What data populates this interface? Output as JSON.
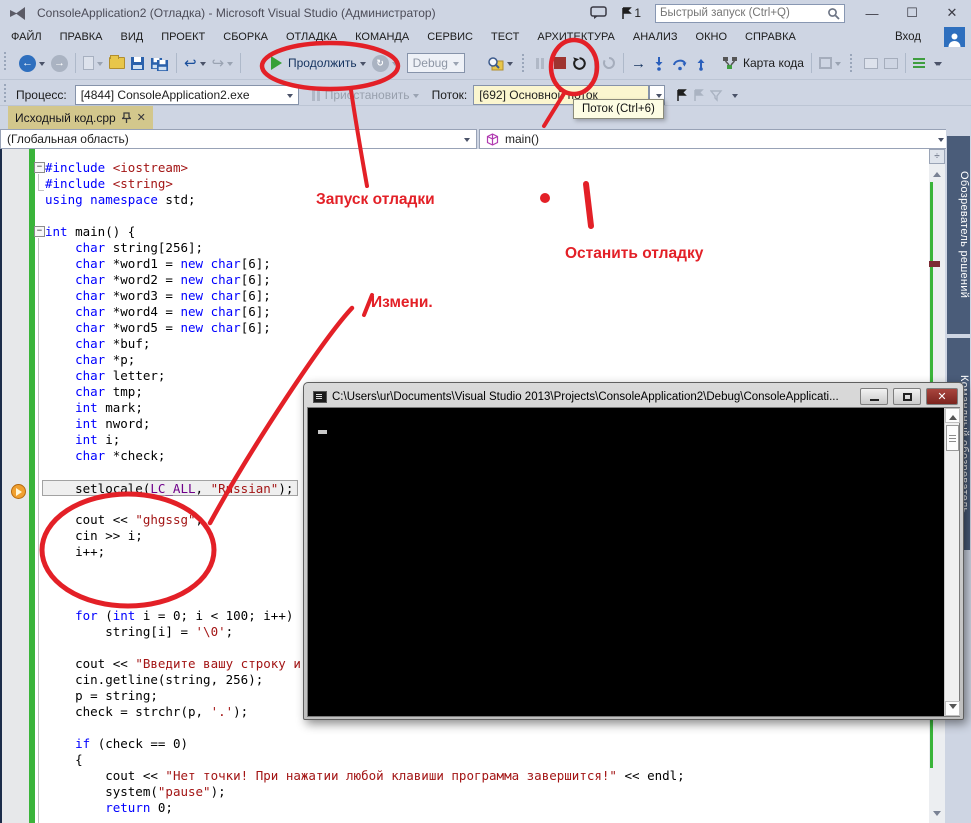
{
  "titlebar": {
    "title": "ConsoleApplication2 (Отладка) - Microsoft Visual Studio (Администратор)",
    "search_placeholder": "Быстрый запуск (Ctrl+Q)",
    "notification_count": "1"
  },
  "menu": {
    "items": [
      "ФАЙЛ",
      "ПРАВКА",
      "ВИД",
      "ПРОЕКТ",
      "СБОРКА",
      "ОТЛАДКА",
      "КОМАНДА",
      "СЕРВИС",
      "ТЕСТ",
      "АРХИТЕКТУРА",
      "АНАЛИЗ",
      "ОКНО",
      "СПРАВКА"
    ],
    "sign_in": "Вход"
  },
  "toolbar": {
    "continue_label": "Продолжить",
    "debug_config": "Debug",
    "code_map_label": "Карта кода"
  },
  "process_bar": {
    "process_label": "Процесс:",
    "process_value": "[4844] ConsoleApplication2.exe",
    "pause_label": "Приостановить",
    "thread_label": "Поток:",
    "thread_value": "[692] Основной поток",
    "tooltip": "Поток (Ctrl+6)"
  },
  "editor": {
    "tab_title": "Исходный код.cpp",
    "scope_dropdown": "(Глобальная область)",
    "member_dropdown": "main()"
  },
  "code": {
    "lines": [
      {
        "seg": [
          [
            "k",
            "#include"
          ],
          [
            "p",
            " "
          ],
          [
            "s",
            "<iostream>"
          ]
        ],
        "fold": true
      },
      {
        "seg": [
          [
            "k",
            "#include"
          ],
          [
            "p",
            " "
          ],
          [
            "s",
            "<string>"
          ]
        ]
      },
      {
        "seg": [
          [
            "k",
            "using"
          ],
          [
            "p",
            " "
          ],
          [
            "k",
            "namespace"
          ],
          [
            "p",
            " std;"
          ]
        ]
      },
      {
        "seg": []
      },
      {
        "seg": [
          [
            "k",
            "int"
          ],
          [
            "p",
            " main() {"
          ]
        ],
        "fold": true
      },
      {
        "seg": [
          [
            "p",
            "    "
          ],
          [
            "k",
            "char"
          ],
          [
            "p",
            " string[256];"
          ]
        ]
      },
      {
        "seg": [
          [
            "p",
            "    "
          ],
          [
            "k",
            "char"
          ],
          [
            "p",
            " *word1 = "
          ],
          [
            "k",
            "new"
          ],
          [
            "p",
            " "
          ],
          [
            "k",
            "char"
          ],
          [
            "p",
            "[6];"
          ]
        ]
      },
      {
        "seg": [
          [
            "p",
            "    "
          ],
          [
            "k",
            "char"
          ],
          [
            "p",
            " *word2 = "
          ],
          [
            "k",
            "new"
          ],
          [
            "p",
            " "
          ],
          [
            "k",
            "char"
          ],
          [
            "p",
            "[6];"
          ]
        ]
      },
      {
        "seg": [
          [
            "p",
            "    "
          ],
          [
            "k",
            "char"
          ],
          [
            "p",
            " *word3 = "
          ],
          [
            "k",
            "new"
          ],
          [
            "p",
            " "
          ],
          [
            "k",
            "char"
          ],
          [
            "p",
            "[6];"
          ]
        ]
      },
      {
        "seg": [
          [
            "p",
            "    "
          ],
          [
            "k",
            "char"
          ],
          [
            "p",
            " *word4 = "
          ],
          [
            "k",
            "new"
          ],
          [
            "p",
            " "
          ],
          [
            "k",
            "char"
          ],
          [
            "p",
            "[6];"
          ]
        ]
      },
      {
        "seg": [
          [
            "p",
            "    "
          ],
          [
            "k",
            "char"
          ],
          [
            "p",
            " *word5 = "
          ],
          [
            "k",
            "new"
          ],
          [
            "p",
            " "
          ],
          [
            "k",
            "char"
          ],
          [
            "p",
            "[6];"
          ]
        ]
      },
      {
        "seg": [
          [
            "p",
            "    "
          ],
          [
            "k",
            "char"
          ],
          [
            "p",
            " *buf;"
          ]
        ]
      },
      {
        "seg": [
          [
            "p",
            "    "
          ],
          [
            "k",
            "char"
          ],
          [
            "p",
            " *p;"
          ]
        ]
      },
      {
        "seg": [
          [
            "p",
            "    "
          ],
          [
            "k",
            "char"
          ],
          [
            "p",
            " letter;"
          ]
        ]
      },
      {
        "seg": [
          [
            "p",
            "    "
          ],
          [
            "k",
            "char"
          ],
          [
            "p",
            " tmp;"
          ]
        ]
      },
      {
        "seg": [
          [
            "p",
            "    "
          ],
          [
            "k",
            "int"
          ],
          [
            "p",
            " mark;"
          ]
        ]
      },
      {
        "seg": [
          [
            "p",
            "    "
          ],
          [
            "k",
            "int"
          ],
          [
            "p",
            " nword;"
          ]
        ]
      },
      {
        "seg": [
          [
            "p",
            "    "
          ],
          [
            "k",
            "int"
          ],
          [
            "p",
            " i;"
          ]
        ]
      },
      {
        "seg": [
          [
            "p",
            "    "
          ],
          [
            "k",
            "char"
          ],
          [
            "p",
            " *check;"
          ]
        ]
      },
      {
        "seg": []
      },
      {
        "seg": [
          [
            "p",
            "    setlocale("
          ],
          [
            "m",
            "LC_ALL"
          ],
          [
            "p",
            ", "
          ],
          [
            "s",
            "\"Russian\""
          ],
          [
            "p",
            ");"
          ]
        ],
        "hl": true
      },
      {
        "seg": []
      },
      {
        "seg": [
          [
            "p",
            "    cout << "
          ],
          [
            "s",
            "\"ghgssg\""
          ],
          [
            "p",
            ";"
          ]
        ]
      },
      {
        "seg": [
          [
            "p",
            "    cin >> i;"
          ]
        ]
      },
      {
        "seg": [
          [
            "p",
            "    i++;"
          ]
        ]
      },
      {
        "seg": []
      },
      {
        "seg": []
      },
      {
        "seg": []
      },
      {
        "seg": [
          [
            "p",
            "    "
          ],
          [
            "k",
            "for"
          ],
          [
            "p",
            " ("
          ],
          [
            "k",
            "int"
          ],
          [
            "p",
            " i = 0; i < 100; i++)"
          ]
        ]
      },
      {
        "seg": [
          [
            "p",
            "        string[i] = "
          ],
          [
            "s",
            "'\\0'"
          ],
          [
            "p",
            ";"
          ]
        ]
      },
      {
        "seg": []
      },
      {
        "seg": [
          [
            "p",
            "    cout << "
          ],
          [
            "s",
            "\"Введите вашу строку и на"
          ]
        ]
      },
      {
        "seg": [
          [
            "p",
            "    cin.getline(string, 256);"
          ]
        ]
      },
      {
        "seg": [
          [
            "p",
            "    p = string;"
          ]
        ]
      },
      {
        "seg": [
          [
            "p",
            "    check = strchr(p, "
          ],
          [
            "s",
            "'.'"
          ],
          [
            "p",
            ");"
          ]
        ]
      },
      {
        "seg": []
      },
      {
        "seg": [
          [
            "p",
            "    "
          ],
          [
            "k",
            "if"
          ],
          [
            "p",
            " (check == 0)"
          ]
        ]
      },
      {
        "seg": [
          [
            "p",
            "    {"
          ]
        ]
      },
      {
        "seg": [
          [
            "p",
            "        cout << "
          ],
          [
            "s",
            "\"Нет точки! При нажатии любой клавиши программа завершится!\""
          ],
          [
            "p",
            " << endl;"
          ]
        ]
      },
      {
        "seg": [
          [
            "p",
            "        system("
          ],
          [
            "s",
            "\"pause\""
          ],
          [
            "p",
            ");"
          ]
        ]
      },
      {
        "seg": [
          [
            "p",
            "        "
          ],
          [
            "k",
            "return"
          ],
          [
            "p",
            " 0;"
          ]
        ]
      }
    ]
  },
  "side_tabs": {
    "solution_explorer": "Обозреватель решений",
    "team_explorer": "Командный обозреватель"
  },
  "console": {
    "title": "C:\\Users\\ur\\Documents\\Visual Studio 2013\\Projects\\ConsoleApplication2\\Debug\\ConsoleApplicati..."
  },
  "annotations": {
    "start_debug": "Запуск отладки",
    "stop_debug": "Останить отладку",
    "change": "Измени."
  },
  "colors": {
    "annotation_red": "#e32027",
    "keyword_blue": "#0000ff",
    "string_red": "#a31515",
    "macro_purple": "#6f008a",
    "active_tab_tan": "#d3c78c",
    "change_bar_green": "#3ab43a",
    "stop_red": "#9e3430"
  }
}
